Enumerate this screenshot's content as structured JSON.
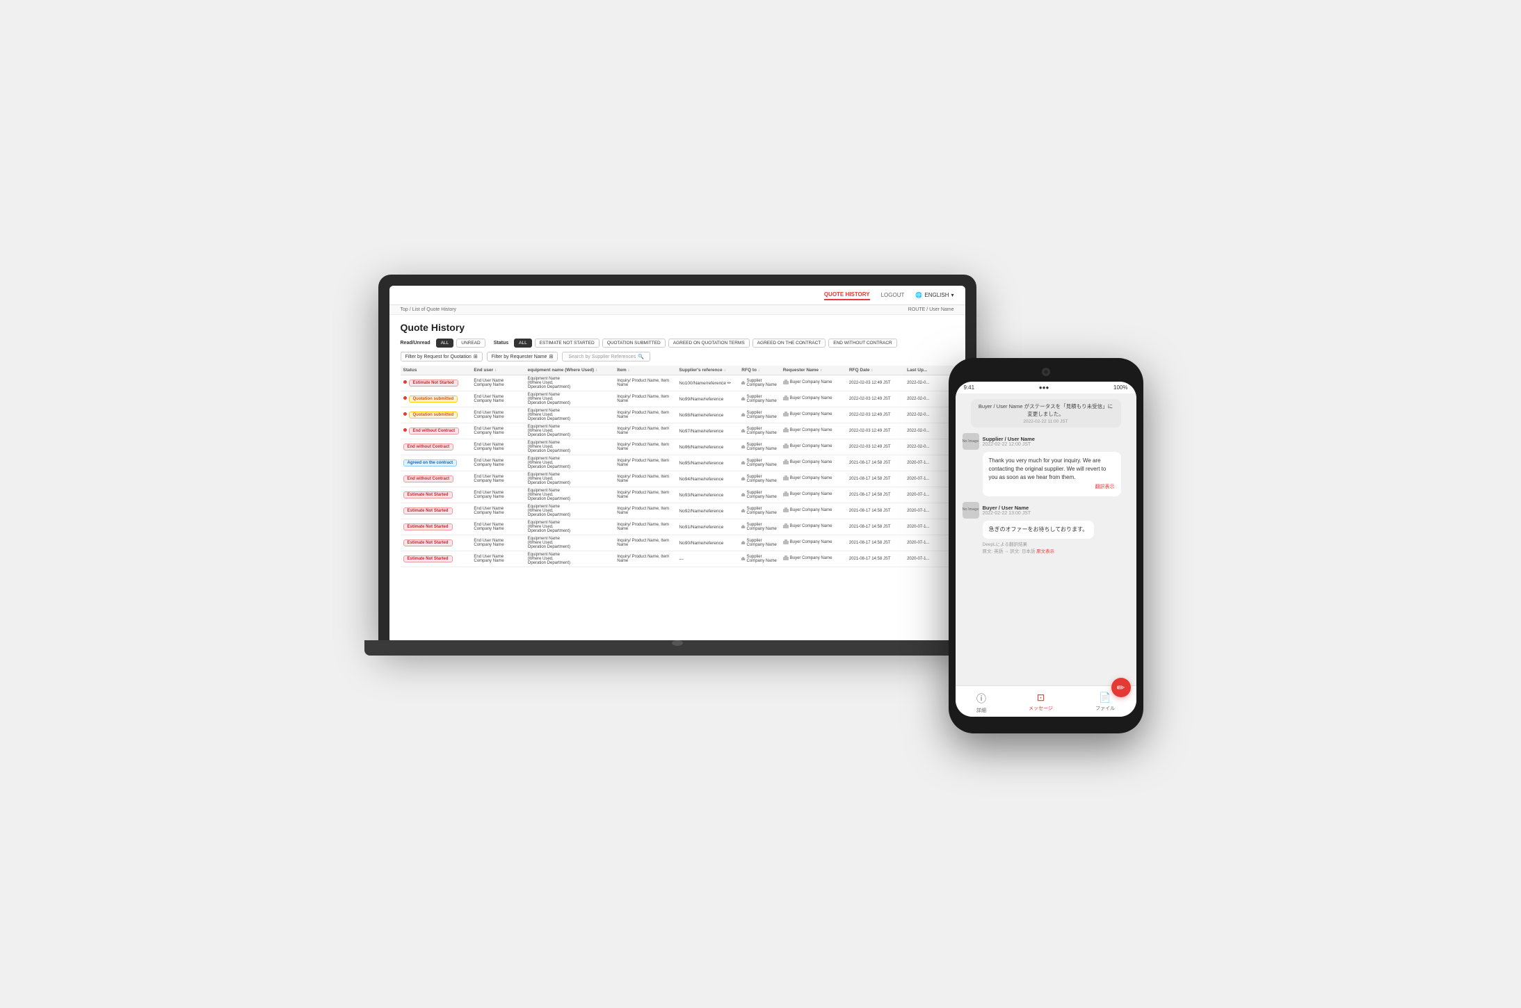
{
  "laptop": {
    "nav": {
      "quote_history": "QUOTE HISTORY",
      "logout": "LOGOUT",
      "language": "ENGLISH"
    },
    "breadcrumb": {
      "top": "Top",
      "separator": "/",
      "current": "List of Quote History",
      "right": "ROUTE / User Name"
    },
    "page_title": "Quote History",
    "read_unread": {
      "label_read": "Read/Unread",
      "tab_all": "ALL",
      "tab_unread": "UNREAD",
      "label_status": "Status",
      "tabs": [
        {
          "label": "ALL",
          "active": true
        },
        {
          "label": "ESTIMATE NOT STARTED",
          "active": false
        },
        {
          "label": "QUOTATION SUBMITTED",
          "active": false
        },
        {
          "label": "AGREED ON QUOTATION TERMS",
          "active": false
        },
        {
          "label": "AGREED ON THE CONTRACT",
          "active": false
        },
        {
          "label": "END WITHOUT CONTRACR",
          "active": false
        }
      ]
    },
    "filters": {
      "request_placeholder": "Filter by Request for Quotation",
      "requester_placeholder": "Filter by Requester Name",
      "search_placeholder": "Search by Supplier References"
    },
    "table": {
      "columns": [
        "Status",
        "End user ↕",
        "equipment name (Where Used) ↕",
        "Item ↕",
        "Supplier's reference ↕",
        "RFQ to ↓",
        "Requester Name ↕",
        "RFQ Date ↕",
        "Last Up..."
      ],
      "rows": [
        {
          "status": "Estimate Not Started",
          "status_type": "not-started",
          "dot": true,
          "end_user": "End User Name\nCompany Name",
          "equipment": "Equipment Name\n(Where Used,\nOperation Department)",
          "item": "Inquiry/ Product Name, Item Name",
          "ref": "No100/Name/reference ✏",
          "rfq": "Supplier Company Name",
          "requester": "Buyer Company Name",
          "rfq_date": "2022-02-03 12:49 JST",
          "last_update": "2022-02-0..."
        },
        {
          "status": "Quotation submitted",
          "status_type": "quotation",
          "dot": true,
          "end_user": "End User Name\nCompany Name",
          "equipment": "Equipment Name\n(Where Used,\nOperation Department)",
          "item": "Inquiry/ Product Name, Item Name",
          "ref": "No99/Name/reference",
          "rfq": "Supplier Company Name",
          "requester": "Buyer Company Name",
          "rfq_date": "2022-02-03 12:49 JST",
          "last_update": "2022-02-0..."
        },
        {
          "status": "Quotation submitted",
          "status_type": "quotation",
          "dot": true,
          "end_user": "End User Name\nCompany Name",
          "equipment": "Equipment Name\n(Where Used,\nOperation Department)",
          "item": "Inquiry/ Product Name, Item Name",
          "ref": "No98/Name/reference",
          "rfq": "Supplier Company Name",
          "requester": "Buyer Company Name",
          "rfq_date": "2022-02-03 12:49 JST",
          "last_update": "2022-02-0..."
        },
        {
          "status": "End without Contract",
          "status_type": "end-without",
          "dot": true,
          "end_user": "End User Name\nCompany Name",
          "equipment": "Equipment Name\n(Where Used,\nOperation Department)",
          "item": "Inquiry/ Product Name, Item Name",
          "ref": "No97/Name/reference",
          "rfq": "Supplier Company Name",
          "requester": "Buyer Company Name",
          "rfq_date": "2022-02-03 12:49 JST",
          "last_update": "2022-02-0..."
        },
        {
          "status": "End without Contract",
          "status_type": "end-without",
          "dot": false,
          "end_user": "End User Name\nCompany Name",
          "equipment": "Equipment Name\n(Where Used,\nOperation Department)",
          "item": "Inquiry/ Product Name, Item Name",
          "ref": "No96/Name/reference",
          "rfq": "Supplier Company Name",
          "requester": "Buyer Company Name",
          "rfq_date": "2022-02-03 12:49 JST",
          "last_update": "2022-02-0..."
        },
        {
          "status": "Agreed on the contract",
          "status_type": "agreed",
          "dot": false,
          "end_user": "End User Name\nCompany Name",
          "equipment": "Equipment Name\n(Where Used,\nOperation Department)",
          "item": "Inquiry/ Product Name, Item Name",
          "ref": "No95/Name/reference",
          "rfq": "Supplier Company Name",
          "requester": "Buyer Company Name",
          "rfq_date": "2021-08-17 14:58 JST",
          "last_update": "2020-07-1..."
        },
        {
          "status": "End without Contract",
          "status_type": "end-without",
          "dot": false,
          "end_user": "End User Name\nCompany Name",
          "equipment": "Equipment Name\n(Where Used,\nOperation Department)",
          "item": "Inquiry/ Product Name, Item Name",
          "ref": "No94/Name/reference",
          "rfq": "Supplier Company Name",
          "requester": "Buyer Company Name",
          "rfq_date": "2021-08-17 14:58 JST",
          "last_update": "2020-07-1..."
        },
        {
          "status": "Estimate Not Started",
          "status_type": "not-started",
          "dot": false,
          "end_user": "End User Name\nCompany Name",
          "equipment": "Equipment Name\n(Where Used,\nOperation Department)",
          "item": "Inquiry/ Product Name, Item Name",
          "ref": "No93/Name/reference",
          "rfq": "Supplier Company Name",
          "requester": "Buyer Company Name",
          "rfq_date": "2021-08-17 14:58 JST",
          "last_update": "2020-07-1..."
        },
        {
          "status": "Estimate Not Started",
          "status_type": "not-started",
          "dot": false,
          "end_user": "End User Name\nCompany Name",
          "equipment": "Equipment Name\n(Where Used,\nOperation Department)",
          "item": "Inquiry/ Product Name, Item Name",
          "ref": "No92/Name/reference",
          "rfq": "Supplier Company Name",
          "requester": "Buyer Company Name",
          "rfq_date": "2021-08-17 14:58 JST",
          "last_update": "2020-07-1..."
        },
        {
          "status": "Estimate Not Started",
          "status_type": "not-started",
          "dot": false,
          "end_user": "End User Name\nCompany Name",
          "equipment": "Equipment Name\n(Where Used,\nOperation Department)",
          "item": "Inquiry/ Product Name, Item Name",
          "ref": "No91/Name/reference",
          "rfq": "Supplier Company Name",
          "requester": "Buyer Company Name",
          "rfq_date": "2021-08-17 14:58 JST",
          "last_update": "2020-07-1..."
        },
        {
          "status": "Estimate Not Started",
          "status_type": "not-started",
          "dot": false,
          "end_user": "End User Name\nCompany Name",
          "equipment": "Equipment Name\n(Where Used,\nOperation Department)",
          "item": "Inquiry/ Product Name, Item Name",
          "ref": "No90/Name/reference",
          "rfq": "Supplier Company Name",
          "requester": "Buyer Company Name",
          "rfq_date": "2021-08-17 14:58 JST",
          "last_update": "2020-07-1..."
        },
        {
          "status": "Estimate Not Started",
          "status_type": "not-started",
          "dot": false,
          "end_user": "End User Name\nCompany Name",
          "equipment": "Equipment Name\n(Where Used,\nOperation Department)",
          "item": "Inquiry/ Product Name, Item Name",
          "ref": "—",
          "rfq": "Supplier Company Name",
          "requester": "Buyer Company Name",
          "rfq_date": "2021-08-17 14:58 JST",
          "last_update": "2020-07-1..."
        }
      ]
    }
  },
  "phone": {
    "status_bar": {
      "time": "9:41",
      "signal": "●●●",
      "battery": "100%"
    },
    "messages": [
      {
        "type": "system",
        "text": "Buyer / User Name がステータスを「見積もり未受信」に変更しました。",
        "time": "2022-02-22 11:00 JST"
      },
      {
        "type": "supplier",
        "sender": "Supplier / User Name",
        "time": "2022-02-22 12:00 JST",
        "avatar_label": "No Image",
        "body": "Thank you very much for your inquiry. We are contacting the original supplier. We will revert to you as soon as we hear from them.",
        "translate_label": "翻訳表示"
      },
      {
        "type": "buyer",
        "sender": "Buyer / User Name",
        "time": "2022-02-22 13:00 JST",
        "avatar_label": "No Image",
        "body": "急ぎのオファーをお待ちしております。",
        "translation_note": "DeepLによる翻訳結果",
        "translation_detail": "原文: 英語 → 訳文: 日本語",
        "original_link": "原文表示"
      }
    ],
    "bottom_nav": [
      {
        "label": "詳細",
        "icon": "ℹ",
        "active": false
      },
      {
        "label": "メッセージ",
        "icon": "💬",
        "active": true
      },
      {
        "label": "ファイル",
        "icon": "📄",
        "active": false
      }
    ],
    "fab_icon": "✏"
  },
  "status_labels": {
    "not_started": "NOT STARTED",
    "agreed_contract": "AGREED ON THE CONTRACT",
    "started": "Started",
    "supplier_company": "Supplier Company Name",
    "buyer_company": "Buyer Company Name",
    "buyer_company_short": "Buyer Company"
  }
}
